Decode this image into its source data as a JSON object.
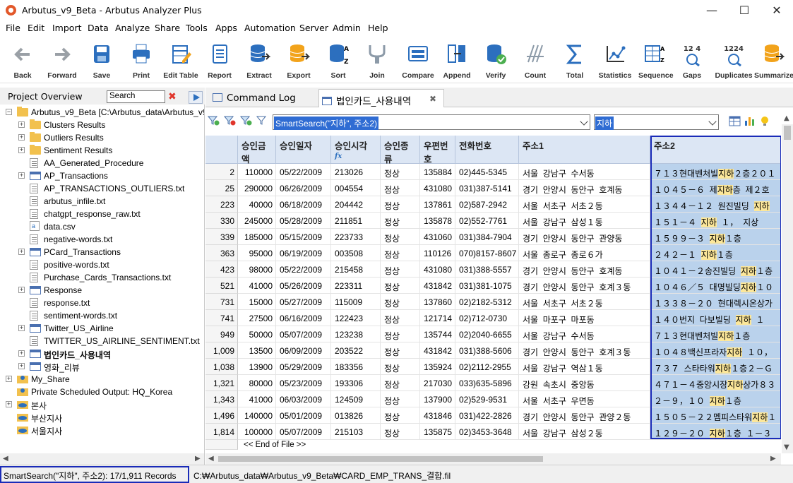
{
  "window": {
    "title": "Arbutus_v9_Beta - Arbutus Analyzer Plus",
    "minimize": "—",
    "maximize": "☐",
    "close": "✕"
  },
  "menu": [
    "File",
    "Edit",
    "Import",
    "Data",
    "Analyze",
    "Share",
    "Tools",
    "Apps",
    "Automation",
    "Server",
    "Admin",
    "Help"
  ],
  "toolbar": [
    {
      "label": "Back",
      "icon": "back-arrow-icon"
    },
    {
      "label": "Forward",
      "icon": "forward-arrow-icon"
    },
    {
      "label": "Save",
      "icon": "save-icon"
    },
    {
      "label": "Print",
      "icon": "print-icon"
    },
    {
      "label": "Edit Table",
      "icon": "edit-table-icon"
    },
    {
      "label": "Report",
      "icon": "report-icon"
    },
    {
      "label": "Extract",
      "icon": "extract-icon"
    },
    {
      "label": "Export",
      "icon": "export-icon"
    },
    {
      "label": "Sort",
      "icon": "sort-icon"
    },
    {
      "label": "Join",
      "icon": "join-icon"
    },
    {
      "label": "Compare",
      "icon": "compare-icon"
    },
    {
      "label": "Append",
      "icon": "append-icon"
    },
    {
      "label": "Verify",
      "icon": "verify-icon"
    },
    {
      "label": "Count",
      "icon": "count-icon"
    },
    {
      "label": "Total",
      "icon": "total-icon"
    },
    {
      "label": "Statistics",
      "icon": "statistics-icon"
    },
    {
      "label": "Sequence",
      "icon": "sequence-icon"
    },
    {
      "label": "Gaps",
      "icon": "gaps-icon",
      "glyph": "12  4"
    },
    {
      "label": "Duplicates",
      "icon": "duplicates-icon",
      "glyph": "1224"
    },
    {
      "label": "Summarize",
      "icon": "summarize-icon"
    }
  ],
  "project": {
    "title": "Project Overview",
    "search_placeholder": "Search",
    "tree": [
      {
        "label": "Arbutus_v9_Beta [C:\\Arbutus_data\\Arbutus_v9",
        "type": "folder-open",
        "level": 0,
        "exp": "−"
      },
      {
        "label": "Clusters Results",
        "type": "folder",
        "level": 1,
        "exp": "+"
      },
      {
        "label": "Outliers Results",
        "type": "folder",
        "level": 1,
        "exp": "+"
      },
      {
        "label": "Sentiment Results",
        "type": "folder",
        "level": 1,
        "exp": "+"
      },
      {
        "label": "AA_Generated_Procedure",
        "type": "script",
        "level": 1,
        "exp": ""
      },
      {
        "label": "AP_Transactions",
        "type": "table",
        "level": 1,
        "exp": "+"
      },
      {
        "label": "AP_TRANSACTIONS_OUTLIERS.txt",
        "type": "text",
        "level": 1,
        "exp": ""
      },
      {
        "label": "arbutus_infile.txt",
        "type": "text",
        "level": 1,
        "exp": ""
      },
      {
        "label": "chatgpt_response_raw.txt",
        "type": "text",
        "level": 1,
        "exp": ""
      },
      {
        "label": "data.csv",
        "type": "csv",
        "level": 1,
        "exp": ""
      },
      {
        "label": "negative-words.txt",
        "type": "text",
        "level": 1,
        "exp": ""
      },
      {
        "label": "PCard_Transactions",
        "type": "table",
        "level": 1,
        "exp": "+"
      },
      {
        "label": "positive-words.txt",
        "type": "text",
        "level": 1,
        "exp": ""
      },
      {
        "label": "Purchase_Cards_Transactions.txt",
        "type": "text",
        "level": 1,
        "exp": ""
      },
      {
        "label": "Response",
        "type": "table",
        "level": 1,
        "exp": "+"
      },
      {
        "label": "response.txt",
        "type": "text",
        "level": 1,
        "exp": ""
      },
      {
        "label": "sentiment-words.txt",
        "type": "text",
        "level": 1,
        "exp": ""
      },
      {
        "label": "Twitter_US_Airline",
        "type": "table",
        "level": 1,
        "exp": "+"
      },
      {
        "label": "TWITTER_US_AIRLINE_SENTIMENT.txt",
        "type": "text",
        "level": 1,
        "exp": ""
      },
      {
        "label": "법인카드_사용내역",
        "type": "table",
        "level": 1,
        "exp": "+",
        "bold": true
      },
      {
        "label": "영화_리뷰",
        "type": "table",
        "level": 1,
        "exp": "+"
      },
      {
        "label": "My_Share",
        "type": "share",
        "level": 0,
        "exp": "+"
      },
      {
        "label": "Private Scheduled Output:  HQ_Korea",
        "type": "share",
        "level": 0,
        "exp": ""
      },
      {
        "label": "본사",
        "type": "cloud",
        "level": 0,
        "exp": "+"
      },
      {
        "label": "부산지사",
        "type": "cloud",
        "level": 0,
        "exp": ""
      },
      {
        "label": "서울지사",
        "type": "cloud",
        "level": 0,
        "exp": ""
      }
    ]
  },
  "tabs": [
    {
      "label": "Command Log",
      "icon": "command-log-icon"
    },
    {
      "label": "법인카드_사용내역",
      "icon": "table-icon",
      "active": true,
      "close": "✖"
    }
  ],
  "filter": {
    "expression": "SmartSearch(\"지하\", 주소2)",
    "quick": "지하"
  },
  "columns": [
    "승인금액",
    "승인일자",
    "승인시각",
    "승인종류",
    "우편번호",
    "전화번호",
    "주소1",
    "주소2"
  ],
  "rows": [
    {
      "n": "2",
      "amt": "110000",
      "date": "05/22/2009",
      "time": "213026",
      "kind": "정상",
      "zip": "135884",
      "tel": "02)445-5345",
      "a1": "서울  강남구  수서동",
      "a2": [
        "７１３현대벤처빌",
        "지하",
        "２층２０１"
      ]
    },
    {
      "n": "25",
      "amt": "290000",
      "date": "06/26/2009",
      "time": "004554",
      "kind": "정상",
      "zip": "431080",
      "tel": "031)387-5141",
      "a1": "경기  안양시  동안구  호계동",
      "a2": [
        "１０４５－６  제",
        "지하",
        "층  제２호"
      ]
    },
    {
      "n": "223",
      "amt": "40000",
      "date": "06/18/2009",
      "time": "204442",
      "kind": "정상",
      "zip": "137861",
      "tel": "02)587-2942",
      "a1": "서울  서초구  서초２동",
      "a2": [
        "１３４４－１２  원진빌딩  ",
        "지하",
        ""
      ]
    },
    {
      "n": "330",
      "amt": "245000",
      "date": "05/28/2009",
      "time": "211851",
      "kind": "정상",
      "zip": "135878",
      "tel": "02)552-7761",
      "a1": "서울  강남구  삼성１동",
      "a2": [
        "１５１－４  ",
        "지하",
        "  １，  지상"
      ]
    },
    {
      "n": "339",
      "amt": "185000",
      "date": "05/15/2009",
      "time": "223733",
      "kind": "정상",
      "zip": "431060",
      "tel": "031)384-7904",
      "a1": "경기  안양시  동안구  관양동",
      "a2": [
        "１５９９－３  ",
        "지하",
        "１층"
      ]
    },
    {
      "n": "363",
      "amt": "95000",
      "date": "06/19/2009",
      "time": "003508",
      "kind": "정상",
      "zip": "110126",
      "tel": "070)8157-8607",
      "a1": "서울  종로구  종로６가",
      "a2": [
        "２４２－１  ",
        "지하",
        "１층"
      ]
    },
    {
      "n": "423",
      "amt": "98000",
      "date": "05/22/2009",
      "time": "215458",
      "kind": "정상",
      "zip": "431080",
      "tel": "031)388-5557",
      "a1": "경기  안양시  동안구  호계동",
      "a2": [
        "１０４１－２송진빌딩  ",
        "지하",
        "１층"
      ]
    },
    {
      "n": "521",
      "amt": "41000",
      "date": "05/26/2009",
      "time": "223311",
      "kind": "정상",
      "zip": "431842",
      "tel": "031)381-1075",
      "a1": "경기  안양시  동안구  호계３동",
      "a2": [
        "１０４６／５  대명빌딩",
        "지하",
        "１０"
      ]
    },
    {
      "n": "731",
      "amt": "15000",
      "date": "05/27/2009",
      "time": "115009",
      "kind": "정상",
      "zip": "137860",
      "tel": "02)2182-5312",
      "a1": "서울  서초구  서초２동",
      "a2": [
        "１３３８－２０  현대렉시온상가",
        "",
        " "
      ]
    },
    {
      "n": "741",
      "amt": "27500",
      "date": "06/16/2009",
      "time": "122423",
      "kind": "정상",
      "zip": "121714",
      "tel": "02)712-0730",
      "a1": "서울  마포구  마포동",
      "a2": [
        "１４０번지  다보빌딩  ",
        "지하",
        "  １"
      ]
    },
    {
      "n": "949",
      "amt": "50000",
      "date": "05/07/2009",
      "time": "123238",
      "kind": "정상",
      "zip": "135744",
      "tel": "02)2040-6655",
      "a1": "서울  강남구  수서동",
      "a2": [
        "７１３현대벤처빌",
        "지하",
        "１층"
      ]
    },
    {
      "n": "1,009",
      "amt": "13500",
      "date": "06/09/2009",
      "time": "203522",
      "kind": "정상",
      "zip": "431842",
      "tel": "031)388-5606",
      "a1": "경기  안양시  동안구  호계３동",
      "a2": [
        "１０４８백신프라자",
        "지하",
        "  １０，"
      ]
    },
    {
      "n": "1,038",
      "amt": "13900",
      "date": "05/29/2009",
      "time": "183356",
      "kind": "정상",
      "zip": "135924",
      "tel": "02)2112-2955",
      "a1": "서울  강남구  역삼１동",
      "a2": [
        "７３７  스타타워",
        "지하",
        "１층２－Ｇ"
      ]
    },
    {
      "n": "1,321",
      "amt": "80000",
      "date": "05/23/2009",
      "time": "193306",
      "kind": "정상",
      "zip": "217030",
      "tel": "033)635-5896",
      "a1": "강원  속초시  중앙동",
      "a2": [
        "４７１－４중앙시장",
        "지하",
        "상가８３"
      ]
    },
    {
      "n": "1,343",
      "amt": "41000",
      "date": "06/03/2009",
      "time": "124509",
      "kind": "정상",
      "zip": "137900",
      "tel": "02)529-9531",
      "a1": "서울  서초구  우면동",
      "a2": [
        "２－９，１０  ",
        "지하",
        "１층"
      ]
    },
    {
      "n": "1,496",
      "amt": "140000",
      "date": "05/01/2009",
      "time": "013826",
      "kind": "정상",
      "zip": "431846",
      "tel": "031)422-2826",
      "a1": "경기  안양시  동안구  관양２동",
      "a2": [
        "１５０５－２２멤피스타워",
        "지하",
        "１"
      ]
    },
    {
      "n": "1,814",
      "amt": "100000",
      "date": "05/07/2009",
      "time": "215103",
      "kind": "정상",
      "zip": "135875",
      "tel": "02)3453-3648",
      "a1": "서울  강남구  삼성２동",
      "a2": [
        "１２９－２０  ",
        "지하",
        "１층  １－３"
      ]
    }
  ],
  "eof": "<< End of File >>",
  "status": {
    "left": "SmartSearch(\"지하\", 주소2): 17/1,911 Records",
    "path": "C:₩Arbutus_data₩Arbutus_v9_Beta₩CARD_EMP_TRANS_결합.fil"
  }
}
